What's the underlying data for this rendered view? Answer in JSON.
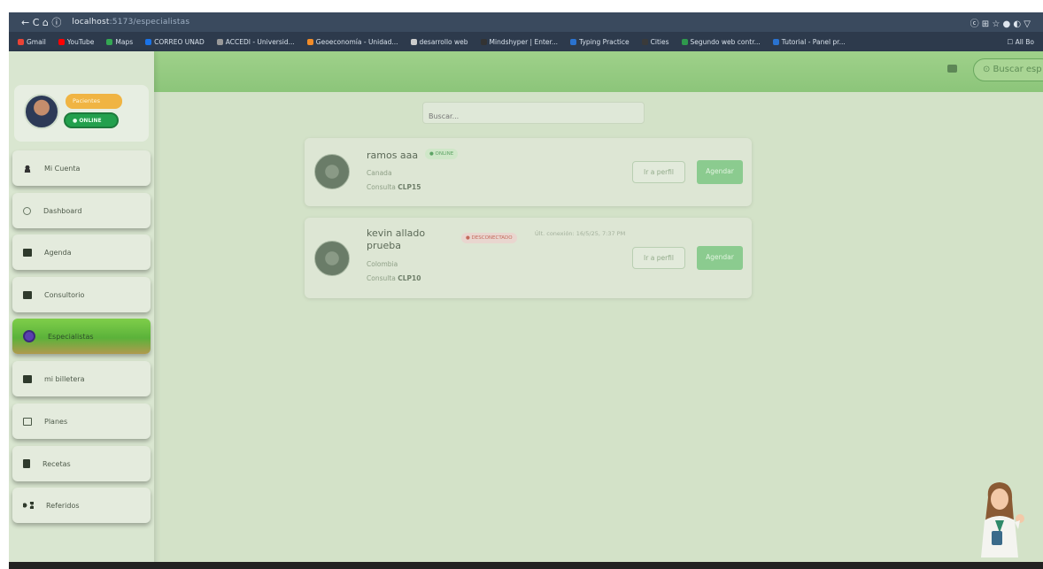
{
  "browser": {
    "nav": "← C ⌂ ⓘ",
    "url_host": "localhost",
    "url_path": ":5173/especialistas",
    "right_icons": "ⓒ ⊞ ☆ ● ◐ ▽"
  },
  "bookmarks": {
    "items": [
      {
        "label": "Gmail",
        "color": "#ea4335"
      },
      {
        "label": "YouTube",
        "color": "#ff0000"
      },
      {
        "label": "Maps",
        "color": "#34a853"
      },
      {
        "label": "CORREO UNAD",
        "color": "#1a73e8"
      },
      {
        "label": "ACCEDI - Universid...",
        "color": "#999999"
      },
      {
        "label": "Geoeconomía - Unidad...",
        "color": "#f28c28"
      },
      {
        "label": "desarrollo web",
        "color": "#cccccc"
      },
      {
        "label": "Mindshyper | Enter...",
        "color": "#333333"
      },
      {
        "label": "Typing Practice",
        "color": "#2a73d0"
      },
      {
        "label": "Cities",
        "color": "#3a3a3a"
      },
      {
        "label": "Segundo web contr...",
        "color": "#2f9a4d"
      },
      {
        "label": "Tutorial - Panel pr...",
        "color": "#2a73d0"
      }
    ],
    "all": "☐ All Bo"
  },
  "header": {
    "menu_icon": "≡",
    "pill_text": "⊙ Buscar esp"
  },
  "profile": {
    "role": "Pacientes",
    "status": "● ONLINE"
  },
  "menu": [
    {
      "label": "Mi Cuenta",
      "icon": "person-icon",
      "active": false
    },
    {
      "label": "Dashboard",
      "icon": "dashboard-icon",
      "active": false
    },
    {
      "label": "Agenda",
      "icon": "calendar-icon",
      "active": false
    },
    {
      "label": "Consultorio",
      "icon": "clinic-icon",
      "active": false
    },
    {
      "label": "Especialistas",
      "icon": "specialist-icon",
      "active": true
    },
    {
      "label": "mi billetera",
      "icon": "wallet-icon",
      "active": false
    },
    {
      "label": "Planes",
      "icon": "plans-icon",
      "active": false
    },
    {
      "label": "Recetas",
      "icon": "recipe-icon",
      "active": false
    },
    {
      "label": "Referidos",
      "icon": "share-icon",
      "active": false
    }
  ],
  "search": {
    "placeholder": "Buscar..."
  },
  "cards": [
    {
      "name": "ramos aaa",
      "status": "● ONLINE",
      "country": "Canada",
      "consult_label": "Consulta",
      "consult_code": "CLP15",
      "profile_button": "Ir a perfil",
      "agendar_button": "Agendar"
    },
    {
      "name": "kevin allado prueba",
      "status": "● DESCONECTADO",
      "last_connection": "Últ. conexión: 16/5/25, 7:37 PM",
      "country": "Colombia",
      "consult_label": "Consulta",
      "consult_code": "CLP10",
      "profile_button": "Ir a perfil",
      "agendar_button": "Agendar"
    }
  ]
}
